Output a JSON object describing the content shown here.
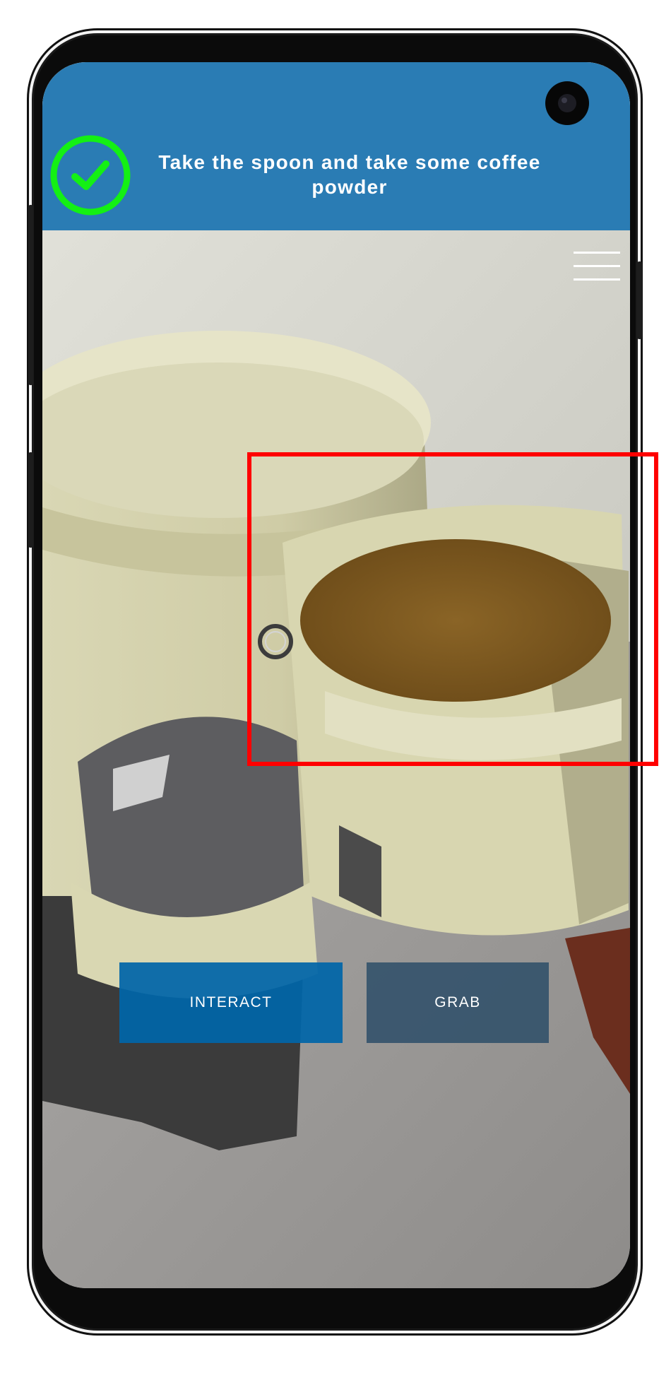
{
  "task": {
    "instruction": "Take the spoon and take some coffee powder",
    "completed": true,
    "icon": "checkmark-circle-icon",
    "banner_color": "#2a7cb4",
    "check_color": "#14f014"
  },
  "toolbar": {
    "menu_icon": "hamburger-menu-icon"
  },
  "actions": {
    "interact_label": "INTERACT",
    "grab_label": "GRAB"
  },
  "scene": {
    "highlight_color": "#ff0000",
    "reticle_icon": "reticle-icon"
  }
}
